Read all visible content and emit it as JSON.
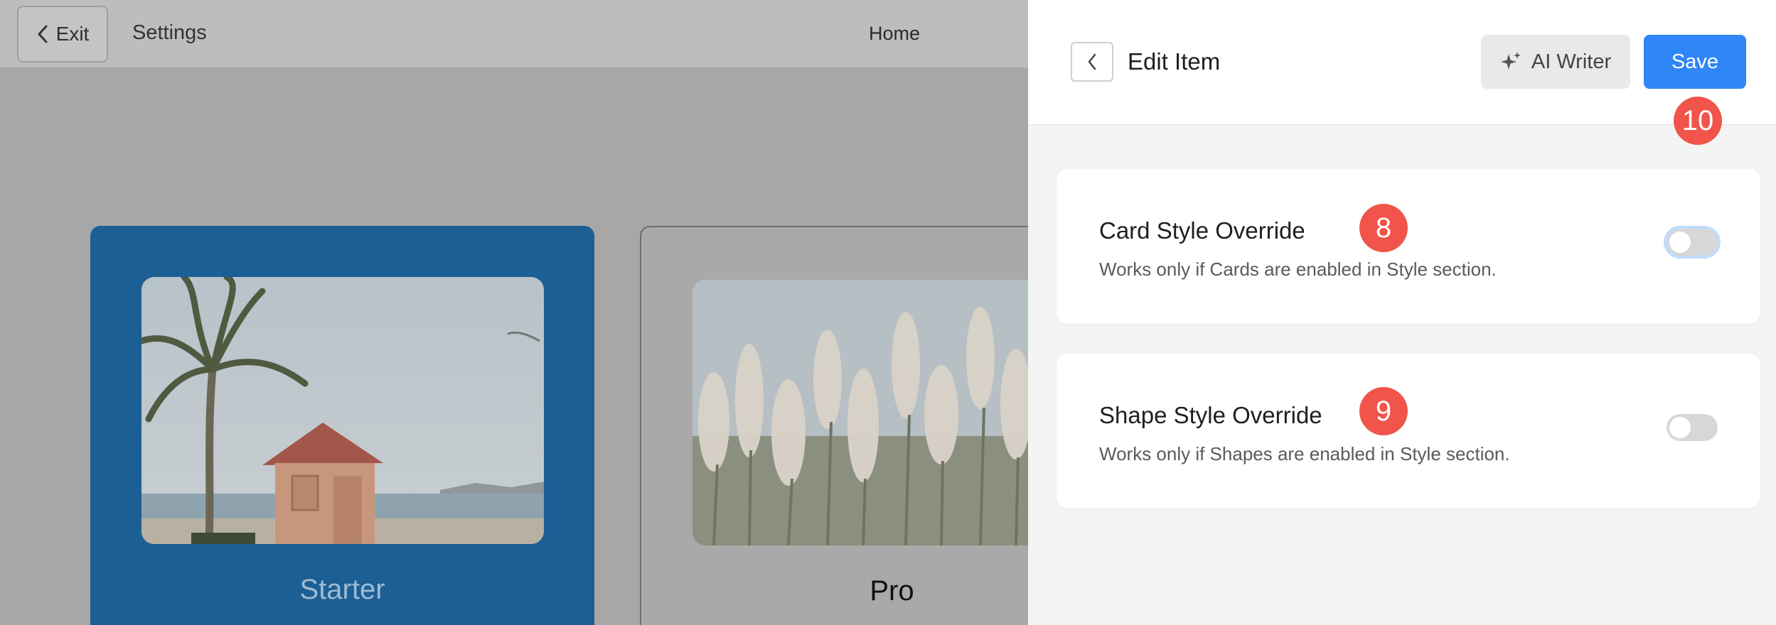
{
  "topbar": {
    "exit_label": "Exit",
    "settings_label": "Settings",
    "home_label": "Home"
  },
  "cards": [
    {
      "title": "Starter",
      "highlight_color": "#1c5f95"
    },
    {
      "title": "Pro"
    }
  ],
  "panel": {
    "title": "Edit Item",
    "ai_writer_label": "AI Writer",
    "save_label": "Save",
    "save_badge": "10",
    "accent_color": "#2f86f6",
    "badge_color": "#f1544a",
    "options": [
      {
        "label": "Card Style Override",
        "description": "Works only if Cards are enabled in Style section.",
        "badge": "8",
        "enabled": false
      },
      {
        "label": "Shape Style Override",
        "description": "Works only if Shapes are enabled in Style section.",
        "badge": "9",
        "enabled": false
      }
    ]
  }
}
